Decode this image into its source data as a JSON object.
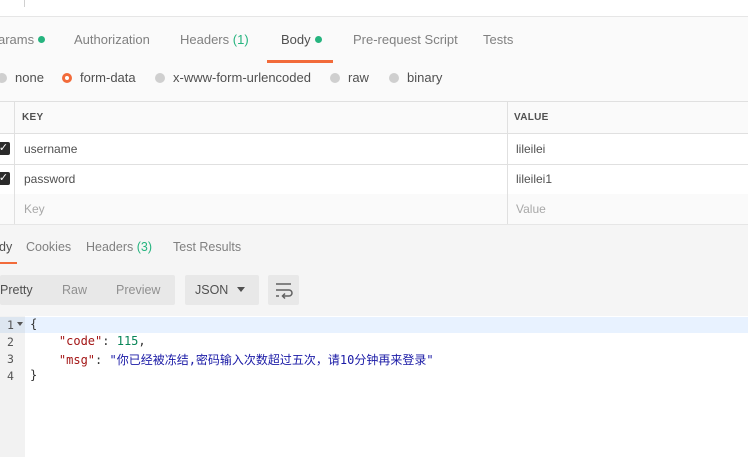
{
  "request_tabs": {
    "params": "arams",
    "authorization": "Authorization",
    "headers_label": "Headers",
    "headers_count": "(1)",
    "body": "Body",
    "prerequest": "Pre-request Script",
    "tests": "Tests"
  },
  "body_types": {
    "none": "none",
    "form_data": "form-data",
    "urlencoded": "x-www-form-urlencoded",
    "raw": "raw",
    "binary": "binary",
    "selected": "form-data"
  },
  "table": {
    "headers": {
      "key": "KEY",
      "value": "VALUE"
    },
    "rows": [
      {
        "checked": true,
        "key": "username",
        "value": "lileilei"
      },
      {
        "checked": true,
        "key": "password",
        "value": "lileilei1"
      }
    ],
    "placeholder": {
      "key": "Key",
      "value": "Value"
    }
  },
  "response_tabs": {
    "body": "dy",
    "cookies": "Cookies",
    "headers_label": "Headers",
    "headers_count": "(3)",
    "test_results": "Test Results"
  },
  "toolbar": {
    "pretty": "Pretty",
    "raw": "Raw",
    "preview": "Preview",
    "format": "JSON"
  },
  "editor": {
    "line_numbers": [
      "1",
      "2",
      "3",
      "4"
    ],
    "open_brace": "{",
    "close_brace": "}",
    "code_key": "\"code\"",
    "code_value": "115",
    "msg_key": "\"msg\"",
    "msg_value": "\"你已经被冻结,密码输入次数超过五次，请10分钟再来登录\""
  },
  "colors": {
    "accent": "#f26b3a",
    "green": "#26b47f"
  }
}
